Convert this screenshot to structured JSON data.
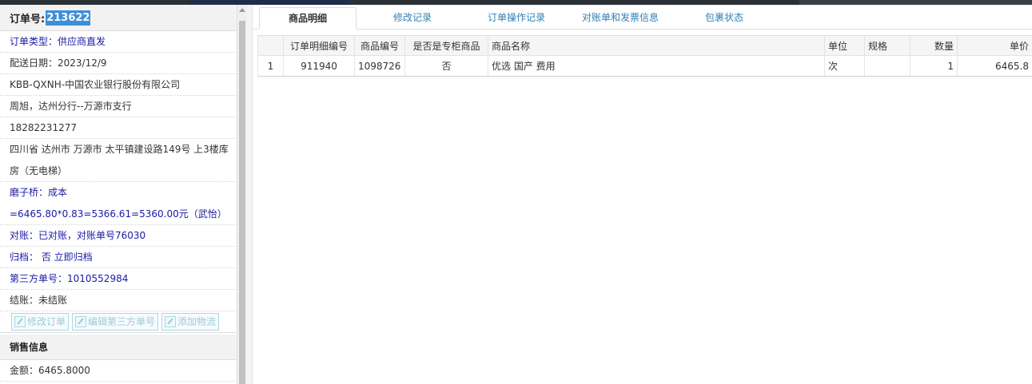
{
  "order": {
    "label": "订单号:",
    "number": "213622",
    "fields": [
      {
        "text": "订单类型：供应商直发",
        "style": "blue"
      },
      {
        "text": "配送日期：2023/12/9",
        "style": "plain"
      },
      {
        "text": "KBB-QXNH-中国农业银行股份有限公司",
        "style": "plain"
      },
      {
        "text": "周旭，达州分行--万源市支行",
        "style": "plain"
      },
      {
        "text": "18282231277",
        "style": "plain"
      }
    ],
    "address": "四川省 达州市 万源市 太平镇建设路149号 上3楼库房（无电梯）",
    "note": "磨子桥：成本=6465.80*0.83=5366.61=5360.00元（武怡）",
    "fields2": [
      {
        "text": "对账：已对账，对账单号76030",
        "style": "blue"
      },
      {
        "text": "归档： 否 立即归档",
        "style": "blue"
      },
      {
        "text": "第三方单号：1010552984",
        "style": "blue"
      },
      {
        "text": "结账：未结账",
        "style": "plain"
      }
    ],
    "buttons": {
      "edit_order": "修改订单",
      "edit_third_party": "编辑第三方单号",
      "add_logistics": "添加物流"
    }
  },
  "sales": {
    "title": "销售信息",
    "amount": "金额：6465.8000"
  },
  "tabs": [
    "商品明细",
    "修改记录",
    "订单操作记录",
    "对账单和发票信息",
    "包裹状态"
  ],
  "active_tab": 0,
  "table": {
    "headers": [
      "",
      "订单明细编号",
      "商品编号",
      "是否是专柜商品",
      "商品名称",
      "单位",
      "规格",
      "数量",
      "单价"
    ],
    "rows": [
      {
        "idx": "1",
        "detail_no": "911940",
        "product_no": "1098726",
        "is_counter": "否",
        "name": "优选 国产 费用",
        "unit": "次",
        "spec": "",
        "qty": "1",
        "price": "6465.8"
      }
    ]
  }
}
